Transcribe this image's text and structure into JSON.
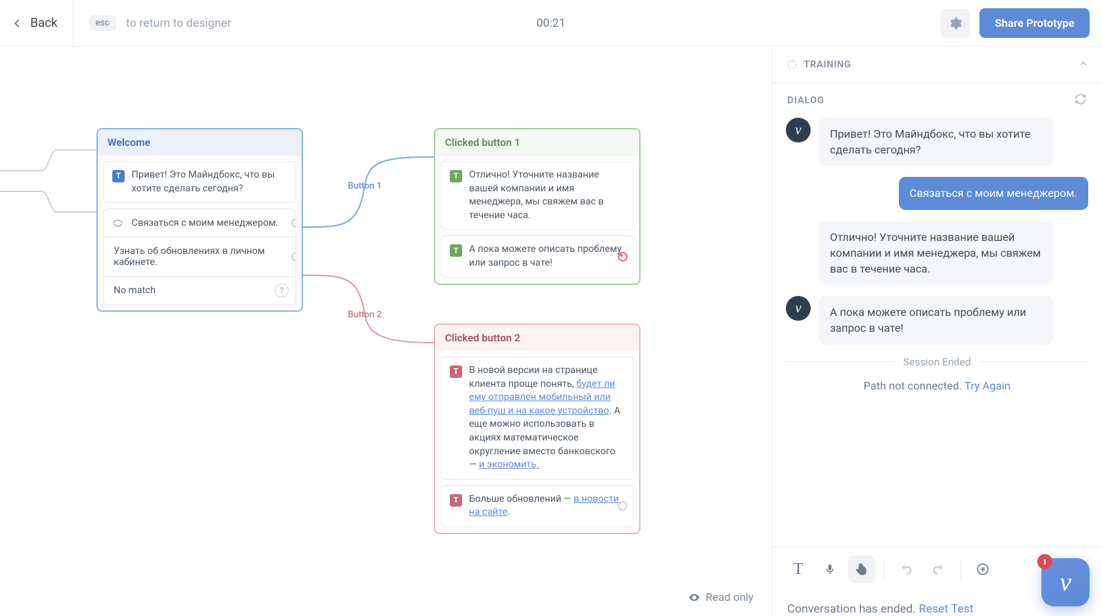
{
  "header": {
    "back_label": "Back",
    "esc_key": "esc",
    "hint": "to return to designer",
    "timer": "00:21",
    "share_label": "Share Prototype"
  },
  "canvas": {
    "readonly_label": "Read only",
    "edge_labels": {
      "button1": "Button 1",
      "button2": "Button 2"
    },
    "welcome": {
      "title": "Welcome",
      "prompt": "Привет! Это Майндбокс, что вы хотите сделать сегодня?",
      "options": {
        "a": "Связаться с моим менеджером.",
        "b": "Узнать об обновлениях в личном кабинете.",
        "c": "No match"
      }
    },
    "clicked1": {
      "title": "Clicked button 1",
      "step1": "Отлично! Уточните название вашей компании и имя менеджера, мы свяжем вас в течение часа.",
      "step2": "А пока можете описать проблему или запрос в чате!"
    },
    "clicked2": {
      "title": "Clicked button 2",
      "step1_a": "В новой версии на странице клиента проще понять, ",
      "step1_link1": "будет ли ему отправлен мобильный или веб-пуш и на какое устройство",
      "step1_b": ". А еще можно использовать в акциях математическое округление вместо банковского — ",
      "step1_link2": "и экономить.",
      "step2_a": "Больше обновлений — ",
      "step2_link": "в новости на сайте",
      "step2_b": "."
    }
  },
  "sidebar": {
    "training_label": "TRAINING",
    "dialog_label": "DIALOG",
    "messages": {
      "bot_greeting": "Привет! Это Майндбокс, что вы хотите сделать сегодня?",
      "user_choice": "Связаться с моим менеджером.",
      "bot_reply1": "Отлично! Уточните название вашей компании и имя менеджера, мы свяжем вас в течение часа.",
      "bot_reply2": "А пока можете описать проблему или запрос в чате!"
    },
    "session_ended": "Session Ended",
    "path_not_connected": "Path not connected.",
    "try_again": "Try Again",
    "conversation_ended": "Conversation has ended.",
    "reset_test": "Reset Test",
    "fab_badge": "1"
  }
}
